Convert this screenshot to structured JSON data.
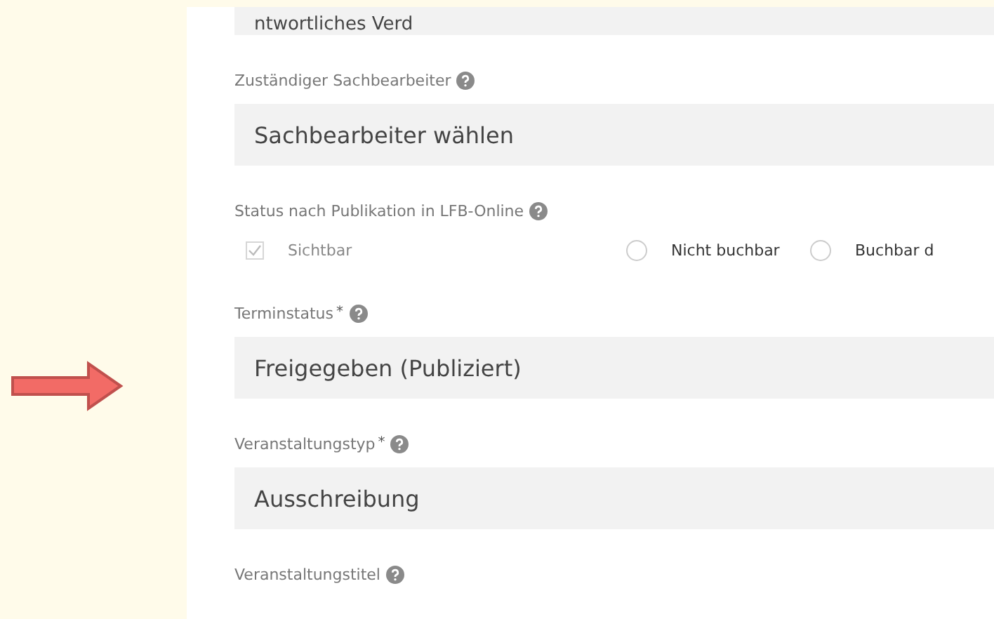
{
  "form": [
    {
      "kind": "select",
      "value": "ntwortliches Verd"
    },
    {
      "kind": "select",
      "label": "Zuständiger Sachbearbeiter",
      "value": "Sachbearbeiter wählen"
    },
    {
      "kind": "options",
      "label": "Status nach Publikation in LFB-Online",
      "options": [
        {
          "kind": "checkbox",
          "label": "Sichtbar",
          "checked": true,
          "disabled": true
        },
        {
          "kind": "radio",
          "label": "Nicht buchbar",
          "selected": false,
          "disabled": false
        },
        {
          "kind": "radio",
          "label": "Buchbar d",
          "selected": false,
          "disabled": false
        }
      ]
    },
    {
      "kind": "select",
      "label": "Terminstatus",
      "required_mark": "*",
      "value": "Freigegeben (Publiziert)"
    },
    {
      "kind": "select",
      "label": "Veranstaltungstyp",
      "required_mark": "*",
      "value": "Ausschreibung"
    },
    {
      "kind": "label",
      "label": "Veranstaltungstitel"
    }
  ]
}
